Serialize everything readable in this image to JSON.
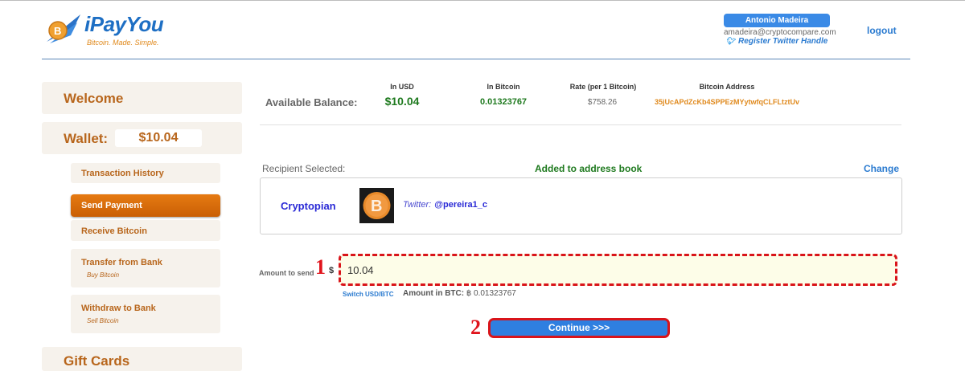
{
  "header": {
    "logo_text": "iPayYou",
    "tagline": "Bitcoin. Made. Simple.",
    "user_name": "Antonio Madeira",
    "user_email": "amadeira@cryptocompare.com",
    "twitter_link": "Register Twitter Handle",
    "logout": "logout"
  },
  "sidebar": {
    "welcome": "Welcome",
    "wallet_label": "Wallet:",
    "wallet_amount": "$10.04",
    "items": [
      {
        "label": "Transaction History"
      },
      {
        "label": "Send Payment",
        "active": true
      },
      {
        "label": "Receive Bitcoin"
      },
      {
        "label": "Transfer from Bank",
        "sublabel": "Buy Bitcoin"
      },
      {
        "label": "Withdraw to Bank",
        "sublabel": "Sell Bitcoin"
      }
    ],
    "gift": "Gift Cards"
  },
  "balance": {
    "label": "Available Balance:",
    "col_usd": "In USD",
    "col_btc": "In Bitcoin",
    "col_rate": "Rate (per 1 Bitcoin)",
    "col_addr": "Bitcoin Address",
    "usd": "$10.04",
    "btc": "0.01323767",
    "rate": "$758.26",
    "address": "35jUcAPdZcKb4SPPEzMYytwfqCLFLtztUv"
  },
  "recipient": {
    "label": "Recipient Selected:",
    "added": "Added to address book",
    "change": "Change",
    "name": "Cryptopian",
    "twitter_label": "Twitter:",
    "twitter_handle": "@pereira1_c"
  },
  "amount": {
    "label": "Amount to send",
    "currency": "$",
    "value": "10.04",
    "switch": "Switch USD/BTC",
    "btc_label": "Amount in BTC:",
    "btc_value": "฿ 0.01323767"
  },
  "steps": {
    "one": "1",
    "two": "2"
  },
  "continue_label": "Continue >>>",
  "colors": {
    "accent_orange": "#b8661c",
    "brand_blue": "#2f7fe0",
    "highlight_red": "#d9141a",
    "positive_green": "#1f7a1f"
  }
}
